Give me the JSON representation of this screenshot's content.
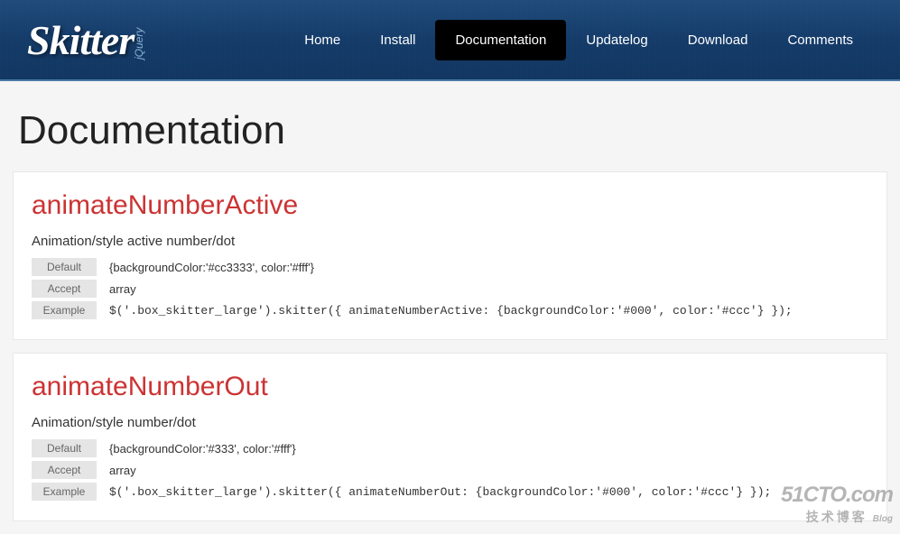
{
  "header": {
    "logo": "Skitter",
    "logo_sub": "jQuery",
    "nav": [
      {
        "label": "Home",
        "active": false
      },
      {
        "label": "Install",
        "active": false
      },
      {
        "label": "Documentation",
        "active": true
      },
      {
        "label": "Updatelog",
        "active": false
      },
      {
        "label": "Download",
        "active": false
      },
      {
        "label": "Comments",
        "active": false
      }
    ]
  },
  "page_title": "Documentation",
  "labels": {
    "default": "Default",
    "accept": "Accept",
    "example": "Example"
  },
  "sections": [
    {
      "title": "animateNumberActive",
      "desc": "Animation/style active number/dot",
      "default": "{backgroundColor:'#cc3333', color:'#fff'}",
      "accept": "array",
      "example": "$('.box_skitter_large').skitter({ animateNumberActive: {backgroundColor:'#000', color:'#ccc'} });"
    },
    {
      "title": "animateNumberOut",
      "desc": "Animation/style number/dot",
      "default": "{backgroundColor:'#333', color:'#fff'}",
      "accept": "array",
      "example": "$('.box_skitter_large').skitter({ animateNumberOut: {backgroundColor:'#000', color:'#ccc'} });"
    }
  ],
  "watermark": {
    "line1": "51CTO.com",
    "line2": "技术博客",
    "blog": "Blog"
  }
}
